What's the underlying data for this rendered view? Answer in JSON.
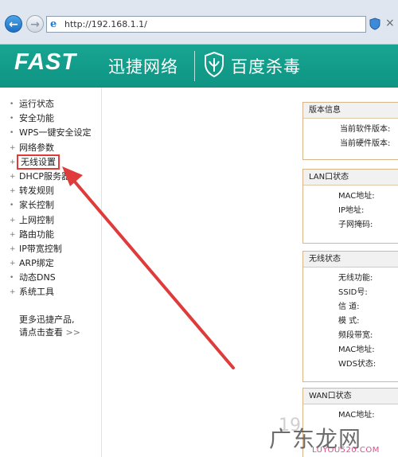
{
  "browser": {
    "back_label": "←",
    "forward_label": "→",
    "address_url": "http://192.168.1.1/",
    "close_glyph": "×"
  },
  "header": {
    "brand": "FAST",
    "brand_cn": "迅捷网络",
    "antivirus": "百度杀毒",
    "bg_color": "#13a08d"
  },
  "sidebar": {
    "items": [
      {
        "label": "运行状态"
      },
      {
        "label": "安全功能"
      },
      {
        "label": "WPS一键安全设定"
      },
      {
        "label": "网络参数"
      },
      {
        "label": "无线设置"
      },
      {
        "label": "DHCP服务器"
      },
      {
        "label": "转发规则"
      },
      {
        "label": "家长控制"
      },
      {
        "label": "上网控制"
      },
      {
        "label": "路由功能"
      },
      {
        "label": "IP带宽控制"
      },
      {
        "label": "ARP绑定"
      },
      {
        "label": "动态DNS"
      },
      {
        "label": "系统工具"
      }
    ],
    "active_index": 4,
    "more_line1": "更多迅捷产品,",
    "more_line2": "请点击查看",
    "more_arrow": ">>"
  },
  "panels": {
    "version": {
      "title": "版本信息",
      "software": "当前软件版本:",
      "hardware": "当前硬件版本:"
    },
    "lan": {
      "title": "LAN口状态",
      "mac": "MAC地址:",
      "ip": "IP地址:",
      "mask": "子网掩码:"
    },
    "wireless": {
      "title": "无线状态",
      "func": "无线功能:",
      "ssid": "SSID号:",
      "channel": "信 道:",
      "mode": "模 式:",
      "bandwidth": "频段带宽:",
      "mac": "MAC地址:",
      "wds": "WDS状态:"
    },
    "wan": {
      "title": "WAN口状态",
      "mac": "MAC地址:"
    }
  },
  "watermark": {
    "big": "广东龙网",
    "num": "19",
    "url": "LUYOU520.COM"
  },
  "colors": {
    "arrow": "#e03b3b",
    "panel_border": "#d9b58a"
  }
}
